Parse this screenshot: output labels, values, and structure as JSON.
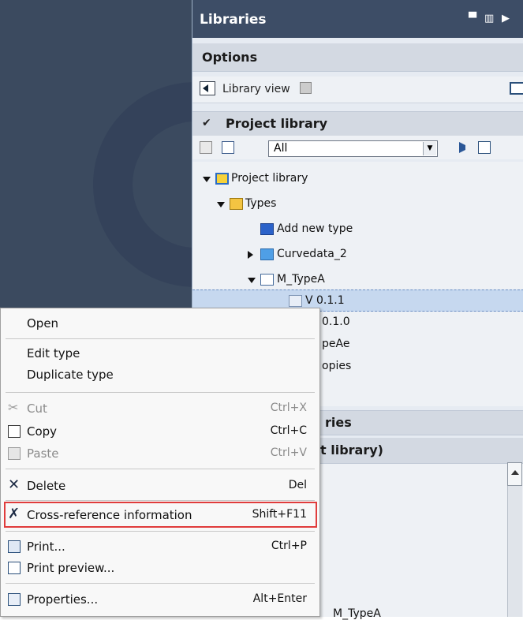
{
  "libraries_pane": {
    "title": "Libraries",
    "options_label": "Options",
    "library_view_label": "Library view",
    "project_library_header": "Project library",
    "filter_value": "All",
    "tree": [
      {
        "label": "Project library",
        "expanded": true,
        "icon": "project-library-icon"
      },
      {
        "label": "Types",
        "expanded": true,
        "icon": "types-folder-icon"
      },
      {
        "label": "Add new type",
        "icon": "add-new-type-icon"
      },
      {
        "label": "Curvedata_2",
        "expanded": false,
        "icon": "type-block-icon"
      },
      {
        "label": "M_TypeA",
        "expanded": true,
        "icon": "type-icon"
      },
      {
        "label": "V 0.1.1",
        "selected": true,
        "icon": "version-icon"
      },
      {
        "label": "0.1.0"
      },
      {
        "label": "peAe"
      },
      {
        "label": "opies"
      }
    ],
    "global_libraries_header": "ries",
    "info_header": "t library)",
    "bottom_partial_label": "M_TypeA"
  },
  "context_menu": {
    "items": [
      {
        "label": "Open",
        "shortcut": ""
      },
      {
        "label": "Edit type",
        "shortcut": ""
      },
      {
        "label": "Duplicate type",
        "shortcut": ""
      },
      {
        "label": "Cut",
        "shortcut": "Ctrl+X",
        "disabled": true,
        "icon": "scissors-icon"
      },
      {
        "label": "Copy",
        "shortcut": "Ctrl+C",
        "icon": "copy-icon"
      },
      {
        "label": "Paste",
        "shortcut": "Ctrl+V",
        "disabled": true,
        "icon": "paste-icon"
      },
      {
        "label": "Delete",
        "shortcut": "Del",
        "icon": "delete-icon"
      },
      {
        "label": "Cross-reference information",
        "shortcut": "Shift+F11",
        "icon": "cross-reference-icon",
        "highlighted": true
      },
      {
        "label": "Print...",
        "shortcut": "Ctrl+P",
        "icon": "print-icon"
      },
      {
        "label": "Print preview...",
        "shortcut": "",
        "icon": "print-preview-icon"
      },
      {
        "label": "Properties...",
        "shortcut": "Alt+Enter",
        "icon": "properties-icon"
      }
    ]
  },
  "colors": {
    "title_bar": "#3d4d66",
    "left_background": "#3b4a5f",
    "selection": "#c6d8ef",
    "highlight_border": "#e03c3c"
  }
}
